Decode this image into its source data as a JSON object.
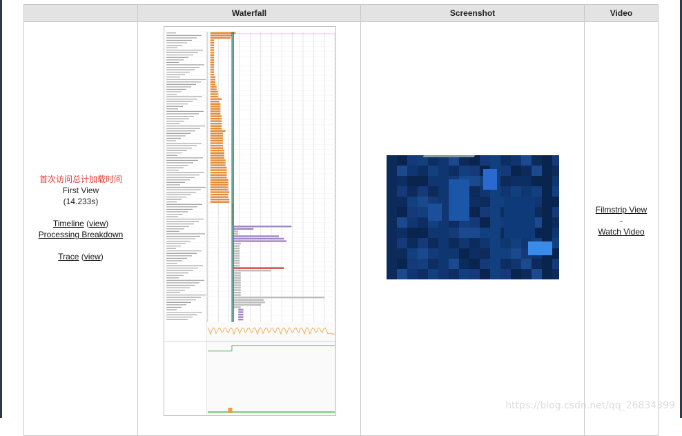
{
  "header": {
    "waterfall": "Waterfall",
    "screenshot": "Screenshot",
    "video": "Video"
  },
  "run": {
    "annotation_cn": "首次访问总计加载时间",
    "view_label": "First View",
    "load_time": "(14.233s)",
    "timeline_label": "Timeline",
    "timeline_view": "view",
    "processing_breakdown": "Processing Breakdown",
    "trace_label": "Trace",
    "trace_view": "view"
  },
  "video": {
    "filmstrip_view": "Filmstrip View",
    "separator": "-",
    "watch_video": "Watch Video"
  },
  "watermark": "https://blog.csdn.net/qq_26834399",
  "colors": {
    "html": "#e38b38",
    "js": "#a385c6",
    "image": "#bdbdbd",
    "highlight": "#d0473e",
    "marker_green": "#3a9f3a",
    "screenshot_bg": "#0c2a5a"
  },
  "waterfall_requests": [
    {
      "start": 0.02,
      "dur": 0.2,
      "c": "h"
    },
    {
      "start": 0.02,
      "dur": 0.17,
      "c": "h"
    },
    {
      "start": 0.02,
      "dur": 0.16,
      "c": "h"
    },
    {
      "start": 0.02,
      "dur": 0.03,
      "c": "h"
    },
    {
      "start": 0.02,
      "dur": 0.03,
      "c": "h"
    },
    {
      "start": 0.02,
      "dur": 0.03,
      "c": "h"
    },
    {
      "start": 0.02,
      "dur": 0.03,
      "c": "h"
    },
    {
      "start": 0.02,
      "dur": 0.03,
      "c": "h"
    },
    {
      "start": 0.02,
      "dur": 0.03,
      "c": "h"
    },
    {
      "start": 0.02,
      "dur": 0.03,
      "c": "h"
    },
    {
      "start": 0.02,
      "dur": 0.03,
      "c": "h"
    },
    {
      "start": 0.02,
      "dur": 0.03,
      "c": "h"
    },
    {
      "start": 0.02,
      "dur": 0.03,
      "c": "h"
    },
    {
      "start": 0.02,
      "dur": 0.03,
      "c": "h"
    },
    {
      "start": 0.02,
      "dur": 0.03,
      "c": "h"
    },
    {
      "start": 0.02,
      "dur": 0.03,
      "c": "h"
    },
    {
      "start": 0.02,
      "dur": 0.03,
      "c": "h"
    },
    {
      "start": 0.02,
      "dur": 0.03,
      "c": "h"
    },
    {
      "start": 0.02,
      "dur": 0.04,
      "c": "h"
    },
    {
      "start": 0.02,
      "dur": 0.04,
      "c": "h"
    },
    {
      "start": 0.02,
      "dur": 0.04,
      "c": "h"
    },
    {
      "start": 0.02,
      "dur": 0.04,
      "c": "h"
    },
    {
      "start": 0.02,
      "dur": 0.05,
      "c": "h"
    },
    {
      "start": 0.02,
      "dur": 0.05,
      "c": "h"
    },
    {
      "start": 0.02,
      "dur": 0.06,
      "c": "h"
    },
    {
      "start": 0.02,
      "dur": 0.06,
      "c": "h"
    },
    {
      "start": 0.02,
      "dur": 0.06,
      "c": "h"
    },
    {
      "start": 0.02,
      "dur": 0.09,
      "c": "h"
    },
    {
      "start": 0.02,
      "dur": 0.07,
      "c": "h"
    },
    {
      "start": 0.02,
      "dur": 0.08,
      "c": "h"
    },
    {
      "start": 0.02,
      "dur": 0.08,
      "c": "h"
    },
    {
      "start": 0.02,
      "dur": 0.08,
      "c": "h"
    },
    {
      "start": 0.02,
      "dur": 0.08,
      "c": "h"
    },
    {
      "start": 0.02,
      "dur": 0.08,
      "c": "h"
    },
    {
      "start": 0.02,
      "dur": 0.09,
      "c": "h"
    },
    {
      "start": 0.02,
      "dur": 0.09,
      "c": "h"
    },
    {
      "start": 0.02,
      "dur": 0.09,
      "c": "h"
    },
    {
      "start": 0.02,
      "dur": 0.09,
      "c": "h"
    },
    {
      "start": 0.02,
      "dur": 0.09,
      "c": "h"
    },
    {
      "start": 0.02,
      "dur": 0.09,
      "c": "h"
    },
    {
      "start": 0.02,
      "dur": 0.12,
      "c": "h"
    },
    {
      "start": 0.02,
      "dur": 0.1,
      "c": "h"
    },
    {
      "start": 0.02,
      "dur": 0.1,
      "c": "h"
    },
    {
      "start": 0.02,
      "dur": 0.1,
      "c": "h"
    },
    {
      "start": 0.02,
      "dur": 0.1,
      "c": "h"
    },
    {
      "start": 0.02,
      "dur": 0.1,
      "c": "h"
    },
    {
      "start": 0.02,
      "dur": 0.1,
      "c": "h"
    },
    {
      "start": 0.02,
      "dur": 0.1,
      "c": "h"
    },
    {
      "start": 0.02,
      "dur": 0.11,
      "c": "h"
    },
    {
      "start": 0.02,
      "dur": 0.11,
      "c": "h"
    },
    {
      "start": 0.02,
      "dur": 0.11,
      "c": "h"
    },
    {
      "start": 0.02,
      "dur": 0.11,
      "c": "h"
    },
    {
      "start": 0.02,
      "dur": 0.12,
      "c": "h"
    },
    {
      "start": 0.02,
      "dur": 0.12,
      "c": "h"
    },
    {
      "start": 0.02,
      "dur": 0.12,
      "c": "h"
    },
    {
      "start": 0.02,
      "dur": 0.13,
      "c": "h"
    },
    {
      "start": 0.02,
      "dur": 0.13,
      "c": "h"
    },
    {
      "start": 0.02,
      "dur": 0.13,
      "c": "h"
    },
    {
      "start": 0.02,
      "dur": 0.13,
      "c": "h"
    },
    {
      "start": 0.02,
      "dur": 0.13,
      "c": "h"
    },
    {
      "start": 0.02,
      "dur": 0.14,
      "c": "h"
    },
    {
      "start": 0.02,
      "dur": 0.14,
      "c": "h"
    },
    {
      "start": 0.02,
      "dur": 0.14,
      "c": "h"
    },
    {
      "start": 0.02,
      "dur": 0.14,
      "c": "h"
    },
    {
      "start": 0.02,
      "dur": 0.14,
      "c": "h"
    },
    {
      "start": 0.02,
      "dur": 0.15,
      "c": "h"
    },
    {
      "start": 0.02,
      "dur": 0.14,
      "c": "h"
    },
    {
      "start": 0.02,
      "dur": 0.14,
      "c": "h"
    },
    {
      "start": 0.02,
      "dur": 0.15,
      "c": "h"
    },
    {
      "start": 0.02,
      "dur": 0.15,
      "c": "h"
    },
    {
      "start": 0.19,
      "dur": 0.01,
      "c": "h"
    },
    {
      "start": 0.19,
      "dur": 0.01,
      "c": "h"
    },
    {
      "start": 0.19,
      "dur": 0.01,
      "c": "h"
    },
    {
      "start": 0.19,
      "dur": 0.01,
      "c": "h"
    },
    {
      "start": 0.19,
      "dur": 0.01,
      "c": "h"
    },
    {
      "start": 0.19,
      "dur": 0.01,
      "c": "h"
    },
    {
      "start": 0.19,
      "dur": 0.01,
      "c": "h"
    },
    {
      "start": 0.19,
      "dur": 0.01,
      "c": "h"
    },
    {
      "start": 0.19,
      "dur": 0.01,
      "c": "h"
    },
    {
      "start": 0.2,
      "dur": 0.46,
      "c": "j"
    },
    {
      "start": 0.2,
      "dur": 0.16,
      "c": "j"
    },
    {
      "start": 0.2,
      "dur": 0.04,
      "c": "i"
    },
    {
      "start": 0.2,
      "dur": 0.04,
      "c": "i"
    },
    {
      "start": 0.2,
      "dur": 0.36,
      "c": "j"
    },
    {
      "start": 0.2,
      "dur": 0.4,
      "c": "j"
    },
    {
      "start": 0.2,
      "dur": 0.42,
      "c": "j"
    },
    {
      "start": 0.2,
      "dur": 0.06,
      "c": "i"
    },
    {
      "start": 0.2,
      "dur": 0.05,
      "c": "i"
    },
    {
      "start": 0.2,
      "dur": 0.05,
      "c": "i"
    },
    {
      "start": 0.2,
      "dur": 0.05,
      "c": "i"
    },
    {
      "start": 0.2,
      "dur": 0.05,
      "c": "i"
    },
    {
      "start": 0.2,
      "dur": 0.05,
      "c": "i"
    },
    {
      "start": 0.2,
      "dur": 0.05,
      "c": "i"
    },
    {
      "start": 0.2,
      "dur": 0.05,
      "c": "i"
    },
    {
      "start": 0.2,
      "dur": 0.05,
      "c": "i"
    },
    {
      "start": 0.2,
      "dur": 0.05,
      "c": "i"
    },
    {
      "start": 0.2,
      "dur": 0.4,
      "c": "r"
    },
    {
      "start": 0.2,
      "dur": 0.3,
      "c": "i"
    },
    {
      "start": 0.2,
      "dur": 0.06,
      "c": "i"
    },
    {
      "start": 0.2,
      "dur": 0.06,
      "c": "i"
    },
    {
      "start": 0.2,
      "dur": 0.06,
      "c": "i"
    },
    {
      "start": 0.2,
      "dur": 0.06,
      "c": "i"
    },
    {
      "start": 0.2,
      "dur": 0.06,
      "c": "i"
    },
    {
      "start": 0.2,
      "dur": 0.06,
      "c": "i"
    },
    {
      "start": 0.2,
      "dur": 0.06,
      "c": "i"
    },
    {
      "start": 0.2,
      "dur": 0.06,
      "c": "i"
    },
    {
      "start": 0.2,
      "dur": 0.06,
      "c": "i"
    },
    {
      "start": 0.2,
      "dur": 0.06,
      "c": "i"
    },
    {
      "start": 0.2,
      "dur": 0.72,
      "c": "i"
    },
    {
      "start": 0.2,
      "dur": 0.24,
      "c": "i"
    },
    {
      "start": 0.2,
      "dur": 0.25,
      "c": "i"
    },
    {
      "start": 0.2,
      "dur": 0.22,
      "c": "i"
    },
    {
      "start": 0.2,
      "dur": 0.06,
      "c": "i"
    },
    {
      "start": 0.24,
      "dur": 0.04,
      "c": "j"
    },
    {
      "start": 0.24,
      "dur": 0.04,
      "c": "j"
    },
    {
      "start": 0.24,
      "dur": 0.04,
      "c": "j"
    },
    {
      "start": 0.24,
      "dur": 0.04,
      "c": "j"
    },
    {
      "start": 0.24,
      "dur": 0.04,
      "c": "j"
    }
  ]
}
